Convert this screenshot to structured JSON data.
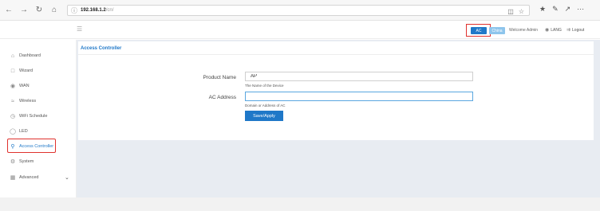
{
  "browser": {
    "url_host": "192.168.1.2",
    "url_path": "/cn/"
  },
  "header": {
    "lang_ac": "AC",
    "lang_cn": "China",
    "welcome": "Welcome Admin",
    "lang_link": "LANG",
    "logout": "Logout"
  },
  "sidebar": {
    "items": [
      {
        "label": "Dashboard",
        "icon": "home-icon"
      },
      {
        "label": "Wizard",
        "icon": "wizard-icon"
      },
      {
        "label": "WAN",
        "icon": "globe-icon"
      },
      {
        "label": "Wireless",
        "icon": "wifi-icon"
      },
      {
        "label": "WiFi Schedule",
        "icon": "clock-icon"
      },
      {
        "label": "LED",
        "icon": "bulb-icon"
      },
      {
        "label": "Access Controller",
        "icon": "pin-icon"
      },
      {
        "label": "System",
        "icon": "gear-icon"
      },
      {
        "label": "Advanced",
        "icon": "grid-icon"
      }
    ],
    "active_index": 6
  },
  "main": {
    "title": "Access Controller",
    "product_name_label": "Product Name",
    "product_name_value": "AP",
    "product_name_hint": "The Name of the Device",
    "ac_address_label": "AC Address",
    "ac_address_value": "",
    "ac_address_hint": "Domain or Address of AC",
    "save_label": "Save/Apply"
  },
  "colors": {
    "accent": "#1f78c8",
    "highlight": "#e0322e"
  }
}
